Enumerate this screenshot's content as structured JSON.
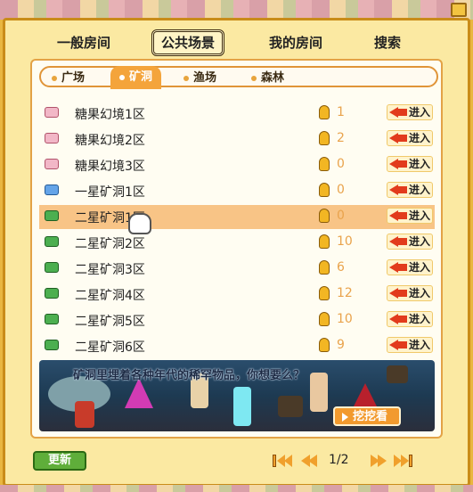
{
  "main_tabs": [
    {
      "label": "一般房间",
      "active": false
    },
    {
      "label": "公共场景",
      "active": true
    },
    {
      "label": "我的房间",
      "active": false
    },
    {
      "label": "搜索",
      "active": false
    }
  ],
  "sub_tabs": [
    {
      "label": "广场",
      "active": false
    },
    {
      "label": "矿洞",
      "active": true
    },
    {
      "label": "渔场",
      "active": false
    },
    {
      "label": "森林",
      "active": false
    }
  ],
  "rooms": [
    {
      "name": "糖果幻境1区",
      "count": "1",
      "icon": "candy-icon",
      "enter": "进入"
    },
    {
      "name": "糖果幻境2区",
      "count": "2",
      "icon": "candy-icon",
      "enter": "进入"
    },
    {
      "name": "糖果幻境3区",
      "count": "0",
      "icon": "candy-icon",
      "enter": "进入"
    },
    {
      "name": "一星矿洞1区",
      "count": "0",
      "icon": "mine-cart-icon",
      "enter": "进入"
    },
    {
      "name": "二星矿洞1区",
      "count": "0",
      "icon": "mine-cart-icon",
      "enter": "进入",
      "highlighted": true
    },
    {
      "name": "二星矿洞2区",
      "count": "10",
      "icon": "mine-cart-icon",
      "enter": "进入"
    },
    {
      "name": "二星矿洞3区",
      "count": "6",
      "icon": "mine-cart-icon",
      "enter": "进入"
    },
    {
      "name": "二星矿洞4区",
      "count": "12",
      "icon": "mine-cart-icon",
      "enter": "进入"
    },
    {
      "name": "二星矿洞5区",
      "count": "10",
      "icon": "mine-cart-icon",
      "enter": "进入"
    },
    {
      "name": "二星矿洞6区",
      "count": "9",
      "icon": "mine-cart-icon",
      "enter": "进入"
    }
  ],
  "banner": {
    "text": "矿洞里埋着各种年代的稀罕物品，你想要么？",
    "button": "挖挖看"
  },
  "footer": {
    "refresh": "更新",
    "page": "1/2"
  },
  "colors": {
    "frame": "#c98c19",
    "panel_bg": "#fbe9a2",
    "highlight_row": "#f8c486",
    "subtab_active": "#f4a43b",
    "count_text": "#e9a34c",
    "enter_arrow": "#e23b1c",
    "refresh_btn": "#5fae3a"
  }
}
